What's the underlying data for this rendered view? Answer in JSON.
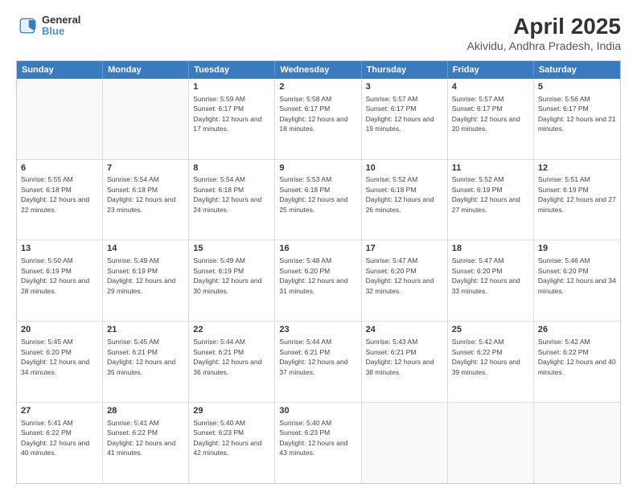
{
  "logo": {
    "line1": "General",
    "line2": "Blue"
  },
  "title": "April 2025",
  "subtitle": "Akividu, Andhra Pradesh, India",
  "headers": [
    "Sunday",
    "Monday",
    "Tuesday",
    "Wednesday",
    "Thursday",
    "Friday",
    "Saturday"
  ],
  "weeks": [
    [
      {
        "day": "",
        "sunrise": "",
        "sunset": "",
        "daylight": ""
      },
      {
        "day": "",
        "sunrise": "",
        "sunset": "",
        "daylight": ""
      },
      {
        "day": "1",
        "sunrise": "Sunrise: 5:59 AM",
        "sunset": "Sunset: 6:17 PM",
        "daylight": "Daylight: 12 hours and 17 minutes."
      },
      {
        "day": "2",
        "sunrise": "Sunrise: 5:58 AM",
        "sunset": "Sunset: 6:17 PM",
        "daylight": "Daylight: 12 hours and 18 minutes."
      },
      {
        "day": "3",
        "sunrise": "Sunrise: 5:57 AM",
        "sunset": "Sunset: 6:17 PM",
        "daylight": "Daylight: 12 hours and 19 minutes."
      },
      {
        "day": "4",
        "sunrise": "Sunrise: 5:57 AM",
        "sunset": "Sunset: 6:17 PM",
        "daylight": "Daylight: 12 hours and 20 minutes."
      },
      {
        "day": "5",
        "sunrise": "Sunrise: 5:56 AM",
        "sunset": "Sunset: 6:17 PM",
        "daylight": "Daylight: 12 hours and 21 minutes."
      }
    ],
    [
      {
        "day": "6",
        "sunrise": "Sunrise: 5:55 AM",
        "sunset": "Sunset: 6:18 PM",
        "daylight": "Daylight: 12 hours and 22 minutes."
      },
      {
        "day": "7",
        "sunrise": "Sunrise: 5:54 AM",
        "sunset": "Sunset: 6:18 PM",
        "daylight": "Daylight: 12 hours and 23 minutes."
      },
      {
        "day": "8",
        "sunrise": "Sunrise: 5:54 AM",
        "sunset": "Sunset: 6:18 PM",
        "daylight": "Daylight: 12 hours and 24 minutes."
      },
      {
        "day": "9",
        "sunrise": "Sunrise: 5:53 AM",
        "sunset": "Sunset: 6:18 PM",
        "daylight": "Daylight: 12 hours and 25 minutes."
      },
      {
        "day": "10",
        "sunrise": "Sunrise: 5:52 AM",
        "sunset": "Sunset: 6:18 PM",
        "daylight": "Daylight: 12 hours and 26 minutes."
      },
      {
        "day": "11",
        "sunrise": "Sunrise: 5:52 AM",
        "sunset": "Sunset: 6:19 PM",
        "daylight": "Daylight: 12 hours and 27 minutes."
      },
      {
        "day": "12",
        "sunrise": "Sunrise: 5:51 AM",
        "sunset": "Sunset: 6:19 PM",
        "daylight": "Daylight: 12 hours and 27 minutes."
      }
    ],
    [
      {
        "day": "13",
        "sunrise": "Sunrise: 5:50 AM",
        "sunset": "Sunset: 6:19 PM",
        "daylight": "Daylight: 12 hours and 28 minutes."
      },
      {
        "day": "14",
        "sunrise": "Sunrise: 5:49 AM",
        "sunset": "Sunset: 6:19 PM",
        "daylight": "Daylight: 12 hours and 29 minutes."
      },
      {
        "day": "15",
        "sunrise": "Sunrise: 5:49 AM",
        "sunset": "Sunset: 6:19 PM",
        "daylight": "Daylight: 12 hours and 30 minutes."
      },
      {
        "day": "16",
        "sunrise": "Sunrise: 5:48 AM",
        "sunset": "Sunset: 6:20 PM",
        "daylight": "Daylight: 12 hours and 31 minutes."
      },
      {
        "day": "17",
        "sunrise": "Sunrise: 5:47 AM",
        "sunset": "Sunset: 6:20 PM",
        "daylight": "Daylight: 12 hours and 32 minutes."
      },
      {
        "day": "18",
        "sunrise": "Sunrise: 5:47 AM",
        "sunset": "Sunset: 6:20 PM",
        "daylight": "Daylight: 12 hours and 33 minutes."
      },
      {
        "day": "19",
        "sunrise": "Sunrise: 5:46 AM",
        "sunset": "Sunset: 6:20 PM",
        "daylight": "Daylight: 12 hours and 34 minutes."
      }
    ],
    [
      {
        "day": "20",
        "sunrise": "Sunrise: 5:45 AM",
        "sunset": "Sunset: 6:20 PM",
        "daylight": "Daylight: 12 hours and 34 minutes."
      },
      {
        "day": "21",
        "sunrise": "Sunrise: 5:45 AM",
        "sunset": "Sunset: 6:21 PM",
        "daylight": "Daylight: 12 hours and 35 minutes."
      },
      {
        "day": "22",
        "sunrise": "Sunrise: 5:44 AM",
        "sunset": "Sunset: 6:21 PM",
        "daylight": "Daylight: 12 hours and 36 minutes."
      },
      {
        "day": "23",
        "sunrise": "Sunrise: 5:44 AM",
        "sunset": "Sunset: 6:21 PM",
        "daylight": "Daylight: 12 hours and 37 minutes."
      },
      {
        "day": "24",
        "sunrise": "Sunrise: 5:43 AM",
        "sunset": "Sunset: 6:21 PM",
        "daylight": "Daylight: 12 hours and 38 minutes."
      },
      {
        "day": "25",
        "sunrise": "Sunrise: 5:42 AM",
        "sunset": "Sunset: 6:22 PM",
        "daylight": "Daylight: 12 hours and 39 minutes."
      },
      {
        "day": "26",
        "sunrise": "Sunrise: 5:42 AM",
        "sunset": "Sunset: 6:22 PM",
        "daylight": "Daylight: 12 hours and 40 minutes."
      }
    ],
    [
      {
        "day": "27",
        "sunrise": "Sunrise: 5:41 AM",
        "sunset": "Sunset: 6:22 PM",
        "daylight": "Daylight: 12 hours and 40 minutes."
      },
      {
        "day": "28",
        "sunrise": "Sunrise: 5:41 AM",
        "sunset": "Sunset: 6:22 PM",
        "daylight": "Daylight: 12 hours and 41 minutes."
      },
      {
        "day": "29",
        "sunrise": "Sunrise: 5:40 AM",
        "sunset": "Sunset: 6:23 PM",
        "daylight": "Daylight: 12 hours and 42 minutes."
      },
      {
        "day": "30",
        "sunrise": "Sunrise: 5:40 AM",
        "sunset": "Sunset: 6:23 PM",
        "daylight": "Daylight: 12 hours and 43 minutes."
      },
      {
        "day": "",
        "sunrise": "",
        "sunset": "",
        "daylight": ""
      },
      {
        "day": "",
        "sunrise": "",
        "sunset": "",
        "daylight": ""
      },
      {
        "day": "",
        "sunrise": "",
        "sunset": "",
        "daylight": ""
      }
    ]
  ]
}
